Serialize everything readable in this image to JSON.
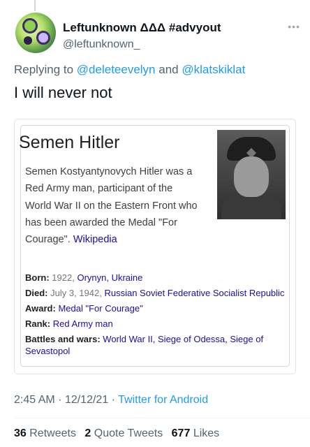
{
  "tweet": {
    "display_name": "Leftunknown ΔΔΔ #advyout",
    "handle": "@leftunknown_",
    "more_label": "•••",
    "replying_prefix": "Replying to",
    "replying_to": [
      "@deleteevelyn",
      "@klatskiklat"
    ],
    "replying_joiner": "and",
    "text": "I will never not"
  },
  "card": {
    "title": "Semen Hitler",
    "description": "Semen Kostyantynovych Hitler was a Red Army man, participant of the World War II on the Eastern Front who has been awarded the Medal \"For Courage\".",
    "source": "Wikipedia",
    "facts": [
      {
        "key": "Born:",
        "plain": "1922,",
        "links": "Orynyn, Ukraine"
      },
      {
        "key": "Died:",
        "plain": "July 3, 1942,",
        "links": "Russian Soviet Federative Socialist Republic"
      },
      {
        "key": "Award:",
        "plain": "",
        "links": "Medal \"For Courage\""
      },
      {
        "key": "Rank:",
        "plain": "",
        "links": "Red Army man"
      },
      {
        "key": "Battles and wars:",
        "plain": "",
        "links": "World War II, Siege of Odessa, Siege of Sevastopol"
      }
    ]
  },
  "meta": {
    "time": "2:45 AM",
    "sep": "·",
    "date": "12/12/21",
    "app": "Twitter for Android"
  },
  "stats": {
    "retweets_count": "36",
    "retweets_label": "Retweets",
    "quotes_count": "2",
    "quotes_label": "Quote Tweets",
    "likes_count": "677",
    "likes_label": "Likes"
  },
  "colors": {
    "link_blue": "#1d9bf0",
    "wiki_link": "#1a0dab",
    "secondary_text": "#536471"
  }
}
